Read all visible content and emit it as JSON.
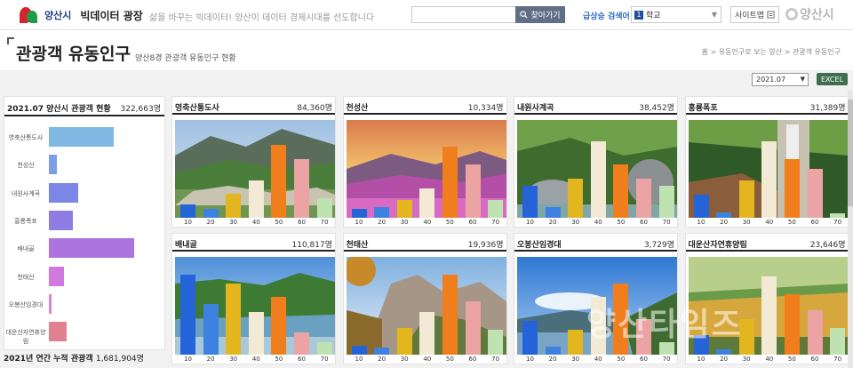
{
  "header": {
    "city": "양산시",
    "site_title": "빅데이터 광장",
    "slogan": "삶을 바꾸는 빅데이터! 양산이 데이터 경제시대를 선도합니다",
    "search_value": "",
    "search_label": "찾아가기",
    "hot_label": "급상승 검색어",
    "hot_rank": "1",
    "hot_item": "학교",
    "sitemap_label": "사이트맵",
    "brand": "양산시"
  },
  "page": {
    "title": "관광객 유동인구",
    "subtitle": "양산8경 관광객 유동인구 현황",
    "breadcrumb": "홈 > 유동인구로 보는 양산 > 관광객 유동인구"
  },
  "controls": {
    "month": "2021.07",
    "excel_label": "EXCEL"
  },
  "summary": {
    "title": "2021.07 양산시 관광객 현황",
    "total": "322,663명",
    "footer_label": "2021년 연간 누적 관광객",
    "footer_value": "1,681,904명",
    "bars": [
      {
        "label": "영축산통도사",
        "value": 84360,
        "color": "#7fb8e3"
      },
      {
        "label": "천성산",
        "value": 10334,
        "color": "#7d9ee6"
      },
      {
        "label": "내원사계곡",
        "value": 38452,
        "color": "#7b86e6"
      },
      {
        "label": "홍룡폭포",
        "value": 31389,
        "color": "#8f7ce3"
      },
      {
        "label": "배내골",
        "value": 110817,
        "color": "#ad73de"
      },
      {
        "label": "천태산",
        "value": 19936,
        "color": "#d07ae0"
      },
      {
        "label": "오봉산임경대",
        "value": 3729,
        "color": "#de84c8"
      },
      {
        "label": "대운산자연휴양림",
        "value": 23646,
        "color": "#e2808f"
      }
    ]
  },
  "age_ticks": [
    "10",
    "20",
    "30",
    "40",
    "50",
    "60",
    "70"
  ],
  "bar_colors": [
    "#2563d9",
    "#3d82e0",
    "#e3b51e",
    "#f2ead5",
    "#f07e1d",
    "#eca3a3",
    "#bfe3b0"
  ],
  "cards": [
    {
      "name": "영축산통도사",
      "value": "84,360명",
      "scene": "sc1",
      "bars": [
        0.15,
        0.1,
        0.27,
        0.42,
        0.82,
        0.66,
        0.22
      ]
    },
    {
      "name": "천성산",
      "value": "10,334명",
      "scene": "sc2",
      "bars": [
        0.1,
        0.12,
        0.2,
        0.33,
        0.8,
        0.6,
        0.2
      ]
    },
    {
      "name": "내원사계곡",
      "value": "38,452명",
      "scene": "sc3",
      "bars": [
        0.36,
        0.12,
        0.44,
        0.86,
        0.6,
        0.44,
        0.36
      ]
    },
    {
      "name": "홍룡폭포",
      "value": "31,389명",
      "scene": "sc4",
      "bars": [
        0.26,
        0.06,
        0.42,
        0.86,
        0.66,
        0.55,
        0.05
      ]
    },
    {
      "name": "배내골",
      "value": "110,817명",
      "scene": "sc5",
      "bars": [
        0.9,
        0.57,
        0.8,
        0.48,
        0.65,
        0.25,
        0.14
      ]
    },
    {
      "name": "천태산",
      "value": "19,936명",
      "scene": "sc6",
      "bars": [
        0.1,
        0.08,
        0.3,
        0.48,
        0.9,
        0.6,
        0.28
      ]
    },
    {
      "name": "오봉산임경대",
      "value": "3,729명",
      "scene": "sc7",
      "bars": [
        0.38,
        0.09,
        0.28,
        0.65,
        0.8,
        0.4,
        0.14
      ]
    },
    {
      "name": "대운산자연휴양림",
      "value": "23,646명",
      "scene": "sc8",
      "bars": [
        0.22,
        0.06,
        0.4,
        0.88,
        0.68,
        0.5,
        0.3
      ]
    }
  ],
  "watermark": "양산타임즈"
}
